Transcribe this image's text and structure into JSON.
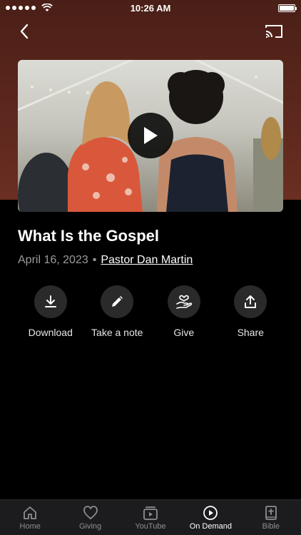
{
  "status_bar": {
    "time": "10:26 AM"
  },
  "video": {
    "title": "What Is the Gospel",
    "date": "April 16, 2023",
    "separator": "•",
    "speaker": "Pastor Dan Martin"
  },
  "actions": [
    {
      "label": "Download",
      "icon": "download-icon"
    },
    {
      "label": "Take a note",
      "icon": "pencil-icon"
    },
    {
      "label": "Give",
      "icon": "heart-hand-icon"
    },
    {
      "label": "Share",
      "icon": "share-icon"
    }
  ],
  "tabs": [
    {
      "label": "Home",
      "icon": "home-icon",
      "active": false
    },
    {
      "label": "Giving",
      "icon": "heart-icon",
      "active": false
    },
    {
      "label": "YouTube",
      "icon": "video-icon",
      "active": false
    },
    {
      "label": "On Demand",
      "icon": "play-circle-icon",
      "active": true
    },
    {
      "label": "Bible",
      "icon": "bible-icon",
      "active": false
    }
  ],
  "colors": {
    "header_bg": "#6b2e22",
    "tabbar_bg": "#1c1c1e",
    "action_bg": "#2a2a2a"
  }
}
